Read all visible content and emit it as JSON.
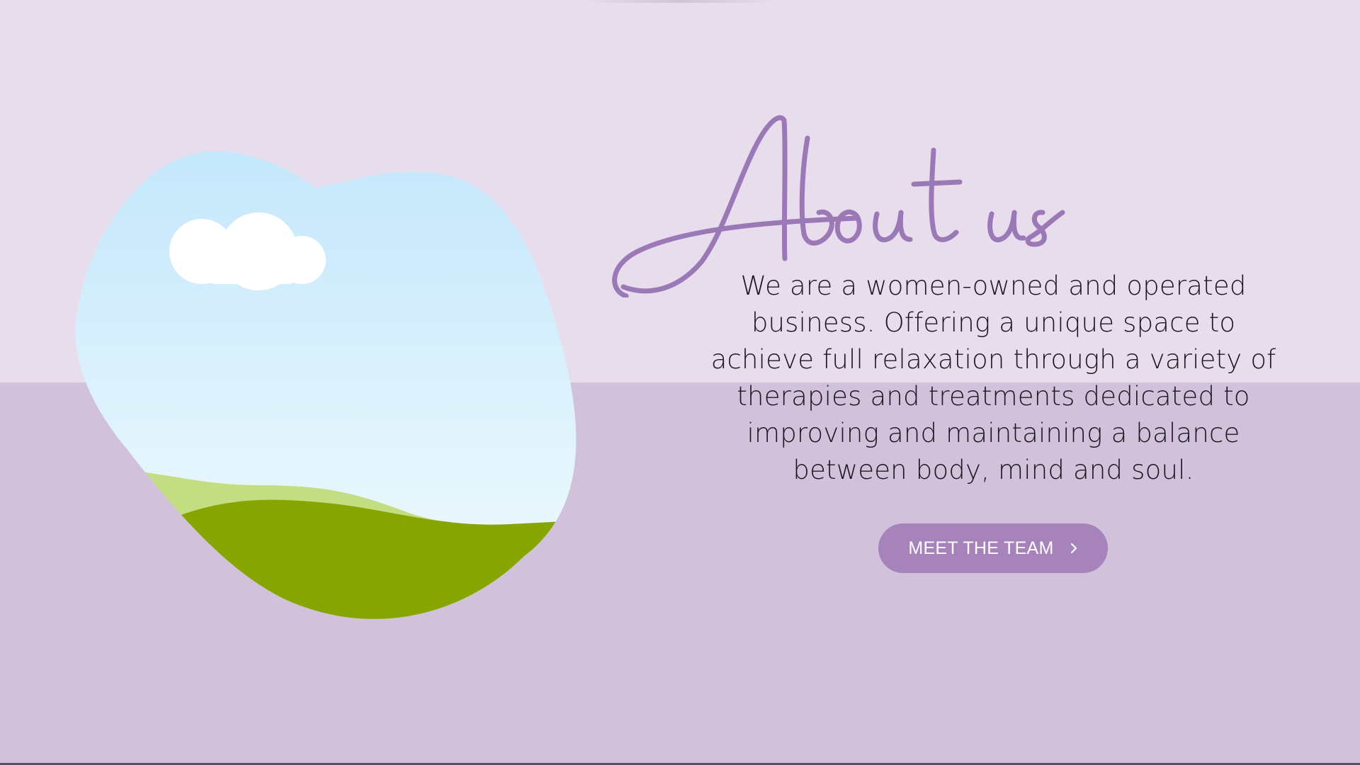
{
  "about": {
    "heading": "About us",
    "description": "We are a women-owned and operated business. Offering a unique space to achieve full relaxation through a variety of therapies and treatments dedicated to improving and maintaining a balance between body, mind and soul.",
    "cta_label": "MEET THE TEAM",
    "cta_icon": "chevron-right-icon"
  },
  "colors": {
    "background_top": "#e8dded",
    "background_bottom": "#d1c1da",
    "accent": "#a684bb",
    "heading": "#9b78b6",
    "text": "#1d1820",
    "sky_top": "#c4e7fb",
    "sky_bottom": "#f2fbfe",
    "hill_light": "#c3dd82",
    "hill_dark": "#87a500",
    "cloud": "#ffffff"
  }
}
